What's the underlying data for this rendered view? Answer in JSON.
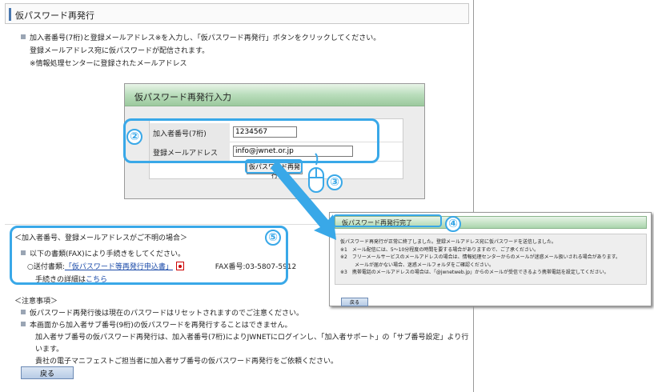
{
  "page": {
    "title": "仮パスワード再発行",
    "intro": [
      "加入者番号(7桁)と登録メールアドレス※を入力し、「仮パスワード再発行」ボタンをクリックしてください。",
      "登録メールアドレス宛に仮パスワードが配信されます。",
      "※情報処理センターに登録されたメールアドレス"
    ]
  },
  "form": {
    "header": "仮パスワード再発行入力",
    "subscriber_label": "加入者番号(7桁)",
    "subscriber_value": "1234567",
    "email_label": "登録メールアドレス",
    "email_value": "info@jwnet.or.jp",
    "submit_label": "仮パスワード再発行"
  },
  "callouts": {
    "c2": "②",
    "c3": "③",
    "c4": "④",
    "c5": "⑤"
  },
  "unknown": {
    "heading": "＜加入者番号、登録メールアドレスがご不明の場合＞",
    "line1": "以下の書類(FAX)により手続きをしてください。",
    "doc_prefix": "○送付書類:",
    "doc_link": "「仮パスワード等再発行申込書」",
    "fax": "FAX番号:03-5807-5912",
    "detail_prefix": "手続きの詳細は",
    "detail_link": "こちら"
  },
  "notes": {
    "heading": "＜注意事項＞",
    "n1": "仮パスワード再発行後は現在のパスワードはリセットされますのでご注意ください。",
    "n2": "本画面から加入者サブ番号(9桁)の仮パスワードを再発行することはできません。",
    "n3": "加入者サブ番号の仮パスワード再発行は、加入者番号(7桁)によりJWNETにログインし、「加入者サポート」の「サブ番号設定」より行います。",
    "n4": "貴社の電子マニフェストご担当者に加入者サブ番号の仮パスワード再発行をご依頼ください。",
    "back": "戻る"
  },
  "complete": {
    "header": "仮パスワード再発行完了",
    "l1": "仮パスワード再発行が正常に終了しました。登録メールアドレス宛に仮パスワードを送信しました。",
    "l2": "※1　メール配信には、5〜10分程度の時間を要する場合がありますので、ご了承ください。",
    "l3": "※2　フリーメールサービスのメールアドレスの場合は、情報処理センターからのメールが迷惑メール扱いされる場合があります。",
    "l4": "メールが届かない場合、迷惑メールフォルダをご確認ください。",
    "l5": "※3　携帯電話のメールアドレスの場合は、「@jwnetweb.jp」からのメールが受信できるよう携帯電話を設定してください。",
    "back": "戻る"
  },
  "colors": {
    "accent": "#39a8e8",
    "header_green": "#b9ddbb"
  }
}
